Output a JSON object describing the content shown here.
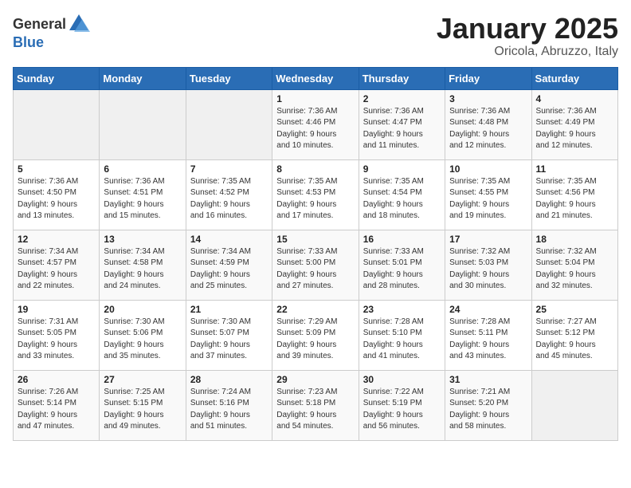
{
  "logo": {
    "text_general": "General",
    "text_blue": "Blue"
  },
  "title": {
    "month": "January 2025",
    "location": "Oricola, Abruzzo, Italy"
  },
  "weekdays": [
    "Sunday",
    "Monday",
    "Tuesday",
    "Wednesday",
    "Thursday",
    "Friday",
    "Saturday"
  ],
  "weeks": [
    [
      {
        "day": "",
        "info": ""
      },
      {
        "day": "",
        "info": ""
      },
      {
        "day": "",
        "info": ""
      },
      {
        "day": "1",
        "info": "Sunrise: 7:36 AM\nSunset: 4:46 PM\nDaylight: 9 hours\nand 10 minutes."
      },
      {
        "day": "2",
        "info": "Sunrise: 7:36 AM\nSunset: 4:47 PM\nDaylight: 9 hours\nand 11 minutes."
      },
      {
        "day": "3",
        "info": "Sunrise: 7:36 AM\nSunset: 4:48 PM\nDaylight: 9 hours\nand 12 minutes."
      },
      {
        "day": "4",
        "info": "Sunrise: 7:36 AM\nSunset: 4:49 PM\nDaylight: 9 hours\nand 12 minutes."
      }
    ],
    [
      {
        "day": "5",
        "info": "Sunrise: 7:36 AM\nSunset: 4:50 PM\nDaylight: 9 hours\nand 13 minutes."
      },
      {
        "day": "6",
        "info": "Sunrise: 7:36 AM\nSunset: 4:51 PM\nDaylight: 9 hours\nand 15 minutes."
      },
      {
        "day": "7",
        "info": "Sunrise: 7:35 AM\nSunset: 4:52 PM\nDaylight: 9 hours\nand 16 minutes."
      },
      {
        "day": "8",
        "info": "Sunrise: 7:35 AM\nSunset: 4:53 PM\nDaylight: 9 hours\nand 17 minutes."
      },
      {
        "day": "9",
        "info": "Sunrise: 7:35 AM\nSunset: 4:54 PM\nDaylight: 9 hours\nand 18 minutes."
      },
      {
        "day": "10",
        "info": "Sunrise: 7:35 AM\nSunset: 4:55 PM\nDaylight: 9 hours\nand 19 minutes."
      },
      {
        "day": "11",
        "info": "Sunrise: 7:35 AM\nSunset: 4:56 PM\nDaylight: 9 hours\nand 21 minutes."
      }
    ],
    [
      {
        "day": "12",
        "info": "Sunrise: 7:34 AM\nSunset: 4:57 PM\nDaylight: 9 hours\nand 22 minutes."
      },
      {
        "day": "13",
        "info": "Sunrise: 7:34 AM\nSunset: 4:58 PM\nDaylight: 9 hours\nand 24 minutes."
      },
      {
        "day": "14",
        "info": "Sunrise: 7:34 AM\nSunset: 4:59 PM\nDaylight: 9 hours\nand 25 minutes."
      },
      {
        "day": "15",
        "info": "Sunrise: 7:33 AM\nSunset: 5:00 PM\nDaylight: 9 hours\nand 27 minutes."
      },
      {
        "day": "16",
        "info": "Sunrise: 7:33 AM\nSunset: 5:01 PM\nDaylight: 9 hours\nand 28 minutes."
      },
      {
        "day": "17",
        "info": "Sunrise: 7:32 AM\nSunset: 5:03 PM\nDaylight: 9 hours\nand 30 minutes."
      },
      {
        "day": "18",
        "info": "Sunrise: 7:32 AM\nSunset: 5:04 PM\nDaylight: 9 hours\nand 32 minutes."
      }
    ],
    [
      {
        "day": "19",
        "info": "Sunrise: 7:31 AM\nSunset: 5:05 PM\nDaylight: 9 hours\nand 33 minutes."
      },
      {
        "day": "20",
        "info": "Sunrise: 7:30 AM\nSunset: 5:06 PM\nDaylight: 9 hours\nand 35 minutes."
      },
      {
        "day": "21",
        "info": "Sunrise: 7:30 AM\nSunset: 5:07 PM\nDaylight: 9 hours\nand 37 minutes."
      },
      {
        "day": "22",
        "info": "Sunrise: 7:29 AM\nSunset: 5:09 PM\nDaylight: 9 hours\nand 39 minutes."
      },
      {
        "day": "23",
        "info": "Sunrise: 7:28 AM\nSunset: 5:10 PM\nDaylight: 9 hours\nand 41 minutes."
      },
      {
        "day": "24",
        "info": "Sunrise: 7:28 AM\nSunset: 5:11 PM\nDaylight: 9 hours\nand 43 minutes."
      },
      {
        "day": "25",
        "info": "Sunrise: 7:27 AM\nSunset: 5:12 PM\nDaylight: 9 hours\nand 45 minutes."
      }
    ],
    [
      {
        "day": "26",
        "info": "Sunrise: 7:26 AM\nSunset: 5:14 PM\nDaylight: 9 hours\nand 47 minutes."
      },
      {
        "day": "27",
        "info": "Sunrise: 7:25 AM\nSunset: 5:15 PM\nDaylight: 9 hours\nand 49 minutes."
      },
      {
        "day": "28",
        "info": "Sunrise: 7:24 AM\nSunset: 5:16 PM\nDaylight: 9 hours\nand 51 minutes."
      },
      {
        "day": "29",
        "info": "Sunrise: 7:23 AM\nSunset: 5:18 PM\nDaylight: 9 hours\nand 54 minutes."
      },
      {
        "day": "30",
        "info": "Sunrise: 7:22 AM\nSunset: 5:19 PM\nDaylight: 9 hours\nand 56 minutes."
      },
      {
        "day": "31",
        "info": "Sunrise: 7:21 AM\nSunset: 5:20 PM\nDaylight: 9 hours\nand 58 minutes."
      },
      {
        "day": "",
        "info": ""
      }
    ]
  ]
}
